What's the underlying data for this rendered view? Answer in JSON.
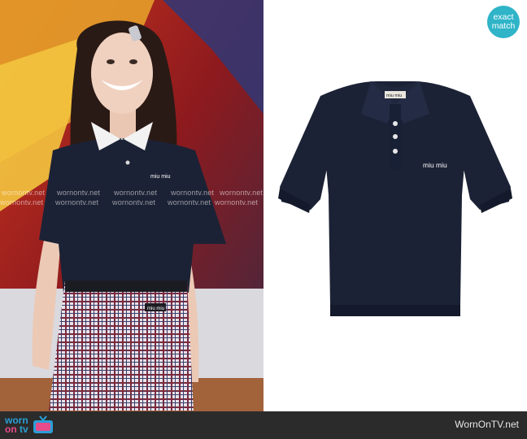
{
  "badge": {
    "line1": "exact",
    "line2": "match"
  },
  "shirt_label": "miu miu",
  "skirt_label": "miu miu",
  "watermark_text": "wornontv.net",
  "footer": {
    "logo_worn": "worn",
    "logo_on": "on",
    "logo_tv": "tv",
    "site": "WornOnTV.net"
  },
  "colors": {
    "navy": "#1c2235",
    "badge": "#2fb4c8",
    "footer": "#2b2b2b",
    "logo_blue": "#2a9fd6"
  }
}
